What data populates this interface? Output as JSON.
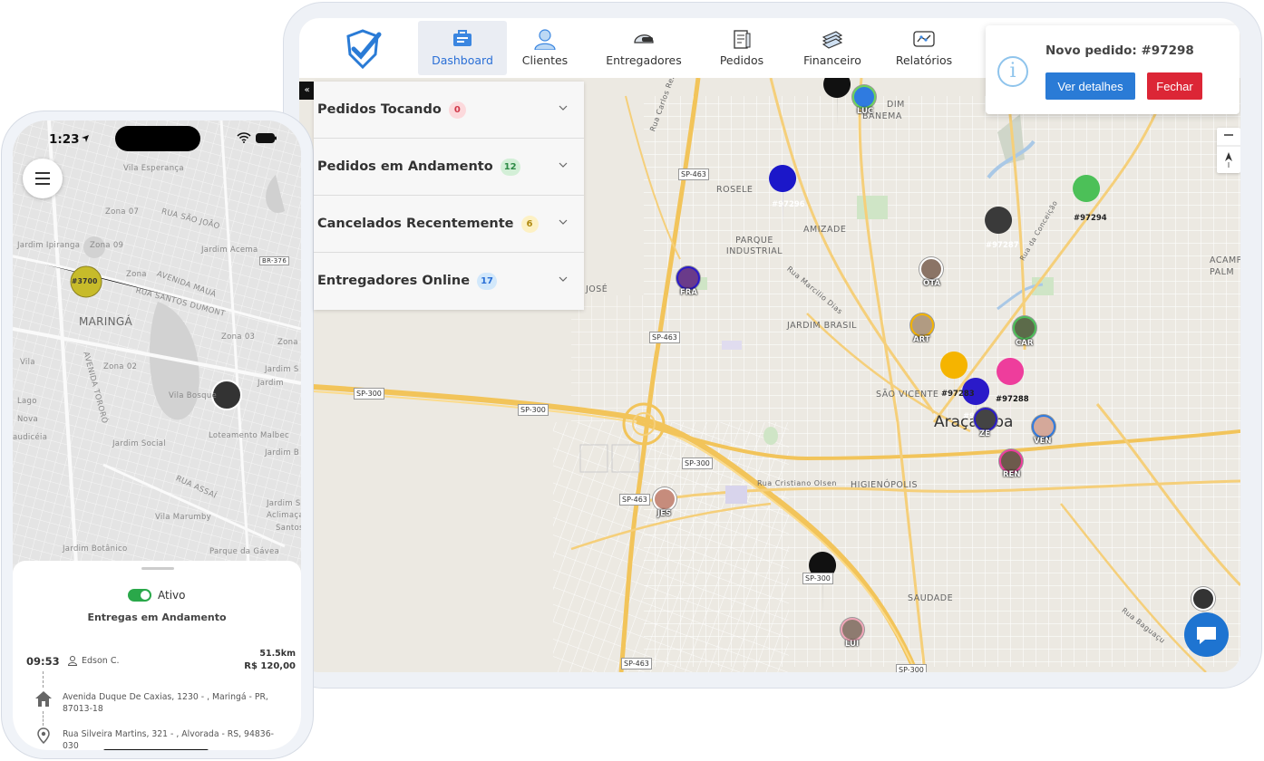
{
  "nav": {
    "items": [
      {
        "label": "Dashboard",
        "icon": "dashboard-icon",
        "active": true
      },
      {
        "label": "Clientes",
        "icon": "user-icon",
        "active": false
      },
      {
        "label": "Entregadores",
        "icon": "helmet-icon",
        "active": false
      },
      {
        "label": "Pedidos",
        "icon": "receipt-icon",
        "active": false
      },
      {
        "label": "Financeiro",
        "icon": "money-icon",
        "active": false
      },
      {
        "label": "Relatórios",
        "icon": "report-icon",
        "active": false
      }
    ]
  },
  "panel": {
    "collapse_glyph": "«",
    "rows": [
      {
        "title": "Pedidos Tocando",
        "count": "0",
        "badge_bg": "#fcd9dc",
        "badge_fg": "#d0394a"
      },
      {
        "title": "Pedidos em Andamento",
        "count": "12",
        "badge_bg": "#d3efd7",
        "badge_fg": "#2d8a45"
      },
      {
        "title": "Cancelados Recentemente",
        "count": "6",
        "badge_bg": "#fdf1c4",
        "badge_fg": "#b08a12"
      },
      {
        "title": "Entregadores Online",
        "count": "17",
        "badge_bg": "#d2e8fb",
        "badge_fg": "#2a6fd6"
      }
    ]
  },
  "toast": {
    "icon": "info-icon",
    "glyph": "i",
    "title": "Novo pedido: #97298",
    "detail_label": "Ver detalhes",
    "close_label": "Fechar"
  },
  "map": {
    "district_labels": [
      "ROSELE",
      "PARQUE INDUSTRIAL",
      "AMIZADE",
      "JARDIM BRASIL",
      "SÃO VICENTE",
      "Araçatuba",
      "HIGIENÓPOLIS",
      "SAUDADE",
      "ACAMP",
      "PALM",
      "JOSÉ",
      "Rua Marcilio Dias",
      "Rua Cristiano Olsen",
      "Rua Baguaçu",
      "Rua Carlos Rezek",
      "DIM",
      "BANEMA",
      "Rua da Conceição"
    ],
    "road_signs": [
      "SP-463",
      "SP-463",
      "SP-300",
      "SP-300",
      "SP-300",
      "SP-463",
      "SP-300",
      "SP-463",
      "SP-300"
    ],
    "order_markers": [
      "#97296",
      "#97294",
      "#97287",
      "#97283",
      "#97297",
      "#97288"
    ],
    "driver_labels": [
      "LUC",
      "FRA",
      "OTA",
      "ART",
      "CAR",
      "VEN",
      "ZE",
      "REN",
      "JES",
      "LUI"
    ]
  },
  "phone": {
    "time": "1:23",
    "map_labels": [
      "Vila Esperança",
      "Zona 07",
      "RUA SÃO JOÃO",
      "Zona 09",
      "Jardim Acema",
      "BR-376",
      "AVENIDA MAUÁ",
      "RUA SANTOS DUMONT",
      "MARINGÁ",
      "Zona 03",
      "AVENIDA TORORÓ",
      "Zona 02",
      "Jardim S",
      "Vila Bosque",
      "Loteamento Malbec",
      "Jardim Social",
      "Jardim B",
      "RUA ASSAÍ",
      "Vila Marumby",
      "Jardim Botânico",
      "Parque da Gávea",
      "Jardim S",
      "Aclimaçao",
      "Santos",
      "Jardim",
      "Lago",
      "Nova",
      "Zona",
      "Zona",
      "Jardim Ipiranga",
      "Vila",
      "audicéia"
    ],
    "marker": "#3700",
    "status_label": "Ativo",
    "sheet_title": "Entregas em Andamento",
    "delivery": {
      "time": "09:53",
      "person": "Edson C.",
      "distance": "51.5km",
      "price": "R$ 120,00",
      "origin": "Avenida Duque De Caxias, 1230 - , Maringá - PR, 87013-18",
      "destination": "Rua Silveira Martins, 321 - , Alvorada - RS, 94836-030"
    }
  },
  "colors": {
    "accent": "#2a7bd6",
    "danger": "#dc2636",
    "road_major": "#f5c76a",
    "road_minor": "#ffffff",
    "map_bg": "#ebe8e1",
    "toggle_on": "#2aa84a"
  }
}
